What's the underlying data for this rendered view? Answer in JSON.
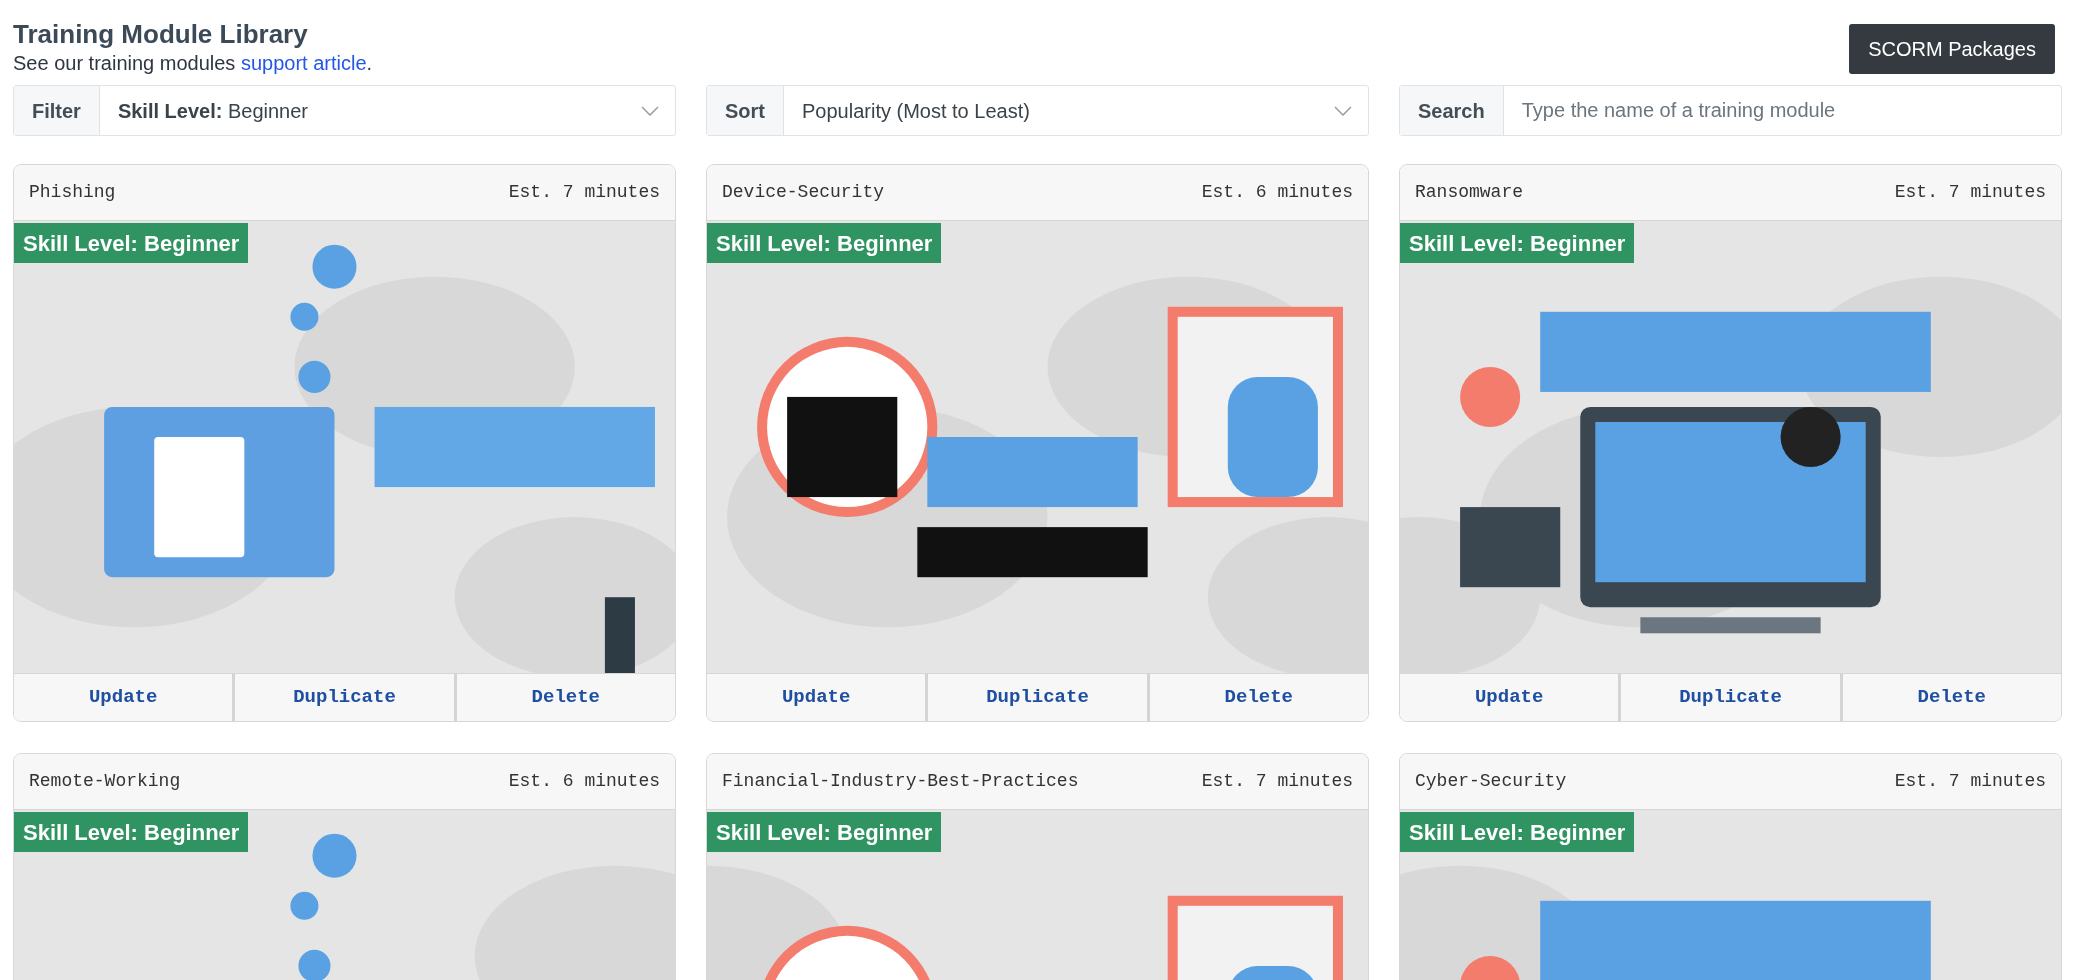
{
  "header": {
    "title": "Training Module Library",
    "subtitle_prefix": "See our training modules ",
    "subtitle_link": "support article",
    "subtitle_suffix": ".",
    "button": "SCORM Packages"
  },
  "controls": [
    {
      "kind": "select",
      "label": "Filter",
      "value_bold": "Skill Level:",
      "value": "Beginner"
    },
    {
      "kind": "select",
      "label": "Sort",
      "value": "Popularity (Most to Least)"
    },
    {
      "kind": "search",
      "label": "Search",
      "placeholder": "Type the name of a training module"
    }
  ],
  "modules": [
    {
      "name": "Phishing",
      "duration": "Est. 7 minutes",
      "badge": "Skill Level: Beginner",
      "actions": [
        "Update",
        "Duplicate",
        "Delete"
      ]
    },
    {
      "name": "Device-Security",
      "duration": "Est. 6 minutes",
      "badge": "Skill Level: Beginner",
      "actions": [
        "Update",
        "Duplicate",
        "Delete"
      ]
    },
    {
      "name": "Ransomware",
      "duration": "Est. 7 minutes",
      "badge": "Skill Level: Beginner",
      "actions": [
        "Update",
        "Duplicate",
        "Delete"
      ]
    },
    {
      "name": "Remote-Working",
      "duration": "Est. 6 minutes",
      "badge": "Skill Level: Beginner"
    },
    {
      "name": "Financial-Industry-Best-Practices",
      "duration": "Est. 7 minutes",
      "badge": "Skill Level: Beginner"
    },
    {
      "name": "Cyber-Security",
      "duration": "Est. 7 minutes",
      "badge": "Skill Level: Beginner"
    }
  ]
}
